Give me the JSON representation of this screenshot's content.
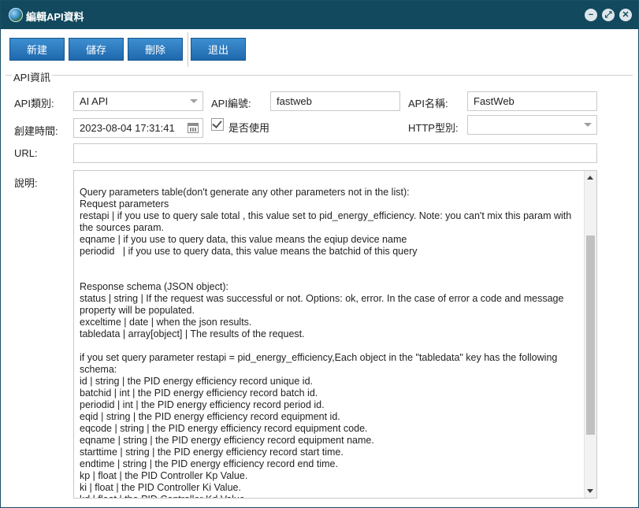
{
  "window": {
    "title": "編輯API資料",
    "controls": {
      "minimize": "−",
      "maximize": "⤢",
      "close": "✕"
    }
  },
  "toolbar": {
    "new_label": "新建",
    "save_label": "儲存",
    "delete_label": "刪除",
    "exit_label": "退出"
  },
  "group": {
    "legend": "API資訊"
  },
  "form": {
    "api_type": {
      "label": "API類別:",
      "value": "AI API"
    },
    "api_code": {
      "label": "API編號:",
      "value": "fastweb"
    },
    "api_name": {
      "label": "API名稱:",
      "value": "FastWeb"
    },
    "created": {
      "label": "創建時間:",
      "value": "2023-08-04 17:31:41"
    },
    "enabled": {
      "label": "是否使用",
      "checked": true
    },
    "http_type": {
      "label": "HTTP型別:",
      "value": ""
    },
    "url": {
      "label": "URL:",
      "value": ""
    },
    "description": {
      "label": "說明:",
      "text": "  -                                                                 -      -\n\nQuery parameters table(don't generate any other parameters not in the list):\nRequest parameters\nrestapi | if you use to query sale total , this value set to pid_energy_efficiency. Note: you can't mix this param with the sources param.\neqname | if you use to query data, this value means the eqiup device name\nperiodid   | if you use to query data, this value means the batchid of this query\n\n\nResponse schema (JSON object):\nstatus | string | If the request was successful or not. Options: ok, error. In the case of error a code and message property will be populated.\nexceltime | date | when the json results.\ntabledata | array[object] | The results of the request.\n\nif you set query parameter restapi = pid_energy_efficiency,Each object in the \"tabledata\" key has the following schema:\nid | string | the PID energy efficiency record unique id.\nbatchid | int | the PID energy efficiency record batch id.\nperiodid | int | the PID energy efficiency record period id.\neqid | string | the PID energy efficiency record equipment id.\neqcode | string | the PID energy efficiency record equipment code.\neqname | string | the PID energy efficiency record equipment name.\nstarttime | string | the PID energy efficiency record start time.\nendtime | string | the PID energy efficiency record end time.\nkp | float | the PID Controller Kp Value.\nki | float | the PID Controller Ki Value.\nkd | float | the PID Controller Kd Value."
    }
  }
}
